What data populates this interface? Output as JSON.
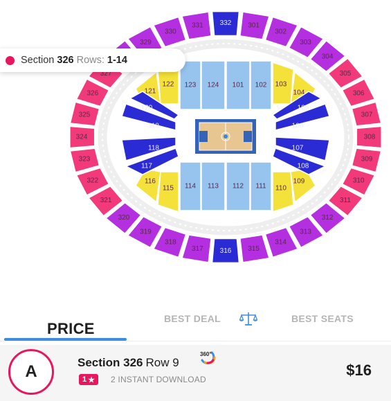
{
  "tooltip": {
    "prefix": "Section",
    "section": "326",
    "rows_label": "Rows:",
    "rows": "1-14"
  },
  "seat_map": {
    "court_icon": "basketball-court-icon",
    "colors": {
      "upper_pink": "#f23a7a",
      "upper_purple": "#b32fe0",
      "upper_blue": "#2b2bd6",
      "lower_lightblue": "#97c3ef",
      "lower_yellow": "#f4e23a",
      "lower_blue": "#2b2bd6",
      "concourse": "#eeeeee"
    },
    "upper_sections": [
      "301",
      "302",
      "303",
      "304",
      "305",
      "306",
      "307",
      "308",
      "309",
      "310",
      "311",
      "312",
      "313",
      "314",
      "315",
      "316",
      "317",
      "318",
      "319",
      "320",
      "321",
      "322",
      "323",
      "324",
      "325",
      "326",
      "327",
      "328",
      "329",
      "330",
      "331",
      "332"
    ],
    "lower_sections": [
      "101",
      "102",
      "103",
      "104",
      "105",
      "106",
      "107",
      "108",
      "109",
      "110",
      "111",
      "112",
      "113",
      "114",
      "115",
      "116",
      "117",
      "118",
      "119",
      "120",
      "121",
      "122",
      "123",
      "124"
    ]
  },
  "tabs": {
    "price": "PRICE",
    "best_deal": "BEST DEAL",
    "best_deal_icon": "scale-icon",
    "best_seats": "BEST SEATS"
  },
  "listing": {
    "avatar_letter": "A",
    "section": "Section 326",
    "row": "Row 9",
    "view_icon": "360-view-icon",
    "badge_count": "1",
    "badge_icon": "star-icon",
    "delivery": "2 INSTANT DOWNLOAD",
    "price": "$16"
  }
}
